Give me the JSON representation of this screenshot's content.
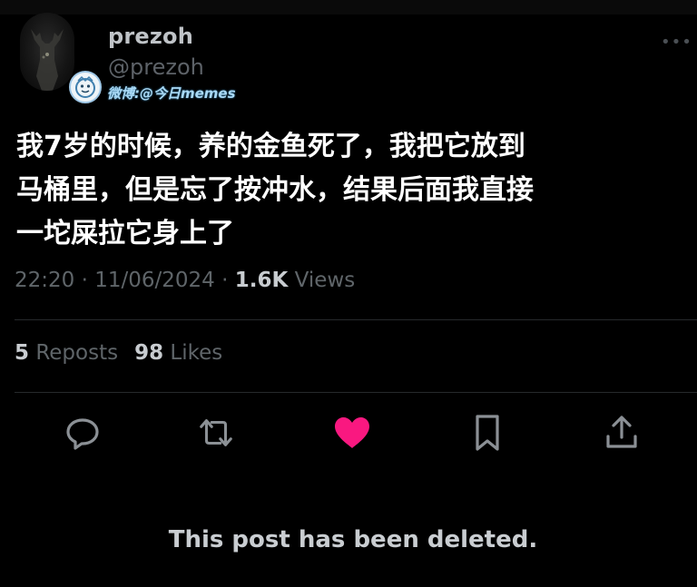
{
  "author": {
    "display_name": "prezoh",
    "handle": "@prezoh"
  },
  "watermark": {
    "text": "微博:@今日memes"
  },
  "tweet": {
    "text": "我7岁的时候，养的金鱼死了，我把它放到\n马桶里，但是忘了按冲水，结果后面我直接\n一坨屎拉它身上了"
  },
  "meta": {
    "time": "22:20",
    "separator": "·",
    "date": "11/06/2024",
    "views_count": "1.6K",
    "views_label": "Views"
  },
  "stats": {
    "reposts_count": "5",
    "reposts_label": "Reposts",
    "likes_count": "98",
    "likes_label": "Likes"
  },
  "actions": [
    {
      "name": "reply",
      "icon": "speech-bubble-icon"
    },
    {
      "name": "repost",
      "icon": "repost-arrows-icon"
    },
    {
      "name": "like",
      "icon": "heart-icon",
      "active": true
    },
    {
      "name": "bookmark",
      "icon": "bookmark-icon"
    },
    {
      "name": "share",
      "icon": "share-upload-icon"
    }
  ],
  "colors": {
    "like_active": "#f91880",
    "icon_default": "#8b9095",
    "watermark": "#a9d9f5"
  },
  "notice": {
    "deleted": "This post has been deleted."
  }
}
